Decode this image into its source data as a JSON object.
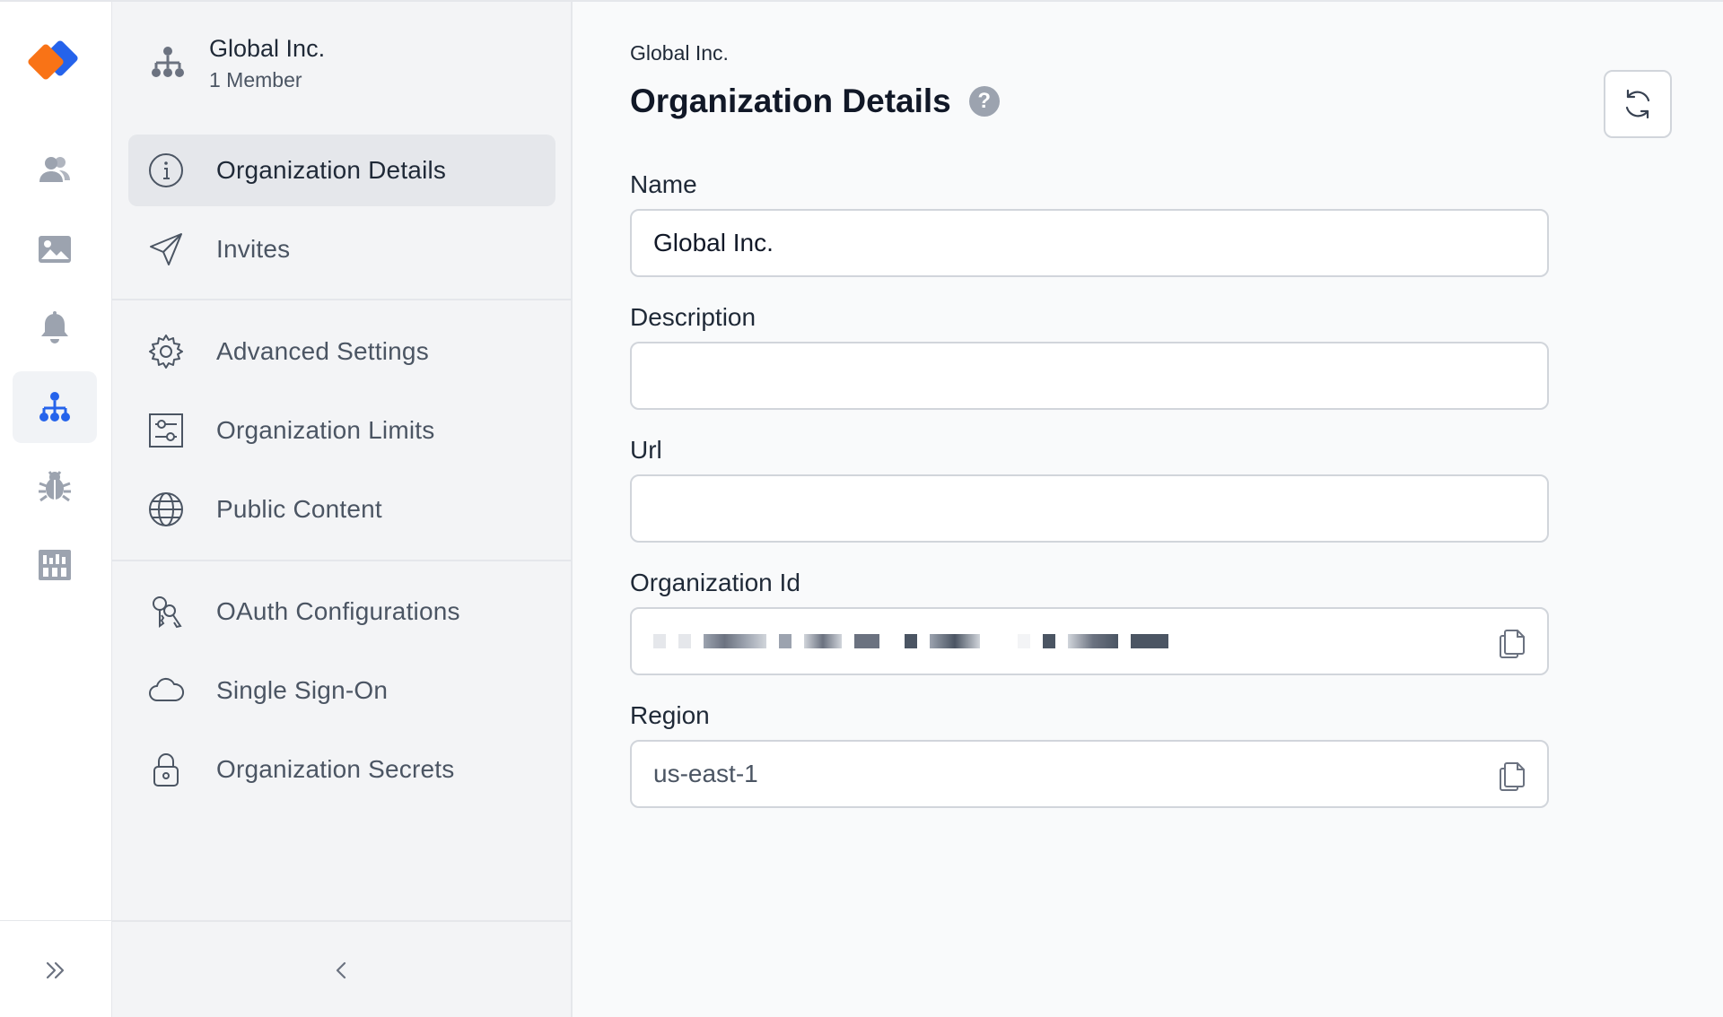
{
  "rail": {
    "items": [
      {
        "icon": "users-icon"
      },
      {
        "icon": "image-icon"
      },
      {
        "icon": "bell-icon"
      },
      {
        "icon": "org-tree-icon",
        "active": true
      },
      {
        "icon": "bug-icon"
      },
      {
        "icon": "dashboard-icon"
      }
    ],
    "accent": "#2563eb",
    "muted": "#9ca3af"
  },
  "org": {
    "name": "Global Inc.",
    "members": "1 Member"
  },
  "nav": {
    "organization_details": "Organization Details",
    "invites": "Invites",
    "advanced_settings": "Advanced Settings",
    "organization_limits": "Organization Limits",
    "public_content": "Public Content",
    "oauth_configurations": "OAuth Configurations",
    "single_sign_on": "Single Sign-On",
    "organization_secrets": "Organization Secrets"
  },
  "main": {
    "breadcrumb": "Global Inc.",
    "title": "Organization Details",
    "help": "?",
    "fields": {
      "name_label": "Name",
      "name_value": "Global Inc.",
      "description_label": "Description",
      "description_value": "",
      "url_label": "Url",
      "url_value": "",
      "org_id_label": "Organization Id",
      "region_label": "Region",
      "region_value": "us-east-1"
    }
  }
}
